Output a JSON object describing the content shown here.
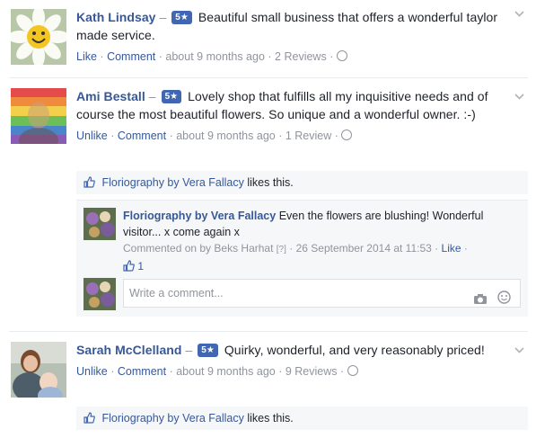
{
  "reviews": [
    {
      "name": "Kath Lindsay",
      "dash": "–",
      "rating": "5★",
      "text": "Beautiful small business that offers a wonderful taylor made service.",
      "actions": {
        "like": "Like",
        "comment": "Comment",
        "time": "about 9 months ago",
        "reviews": "2 Reviews"
      }
    },
    {
      "name": "Ami Bestall",
      "dash": "–",
      "rating": "5★",
      "text": "Lovely shop that fulfills all my inquisitive needs and of course the most beautiful flowers. So unique and a wonderful owner. :-)",
      "actions": {
        "like": "Unlike",
        "comment": "Comment",
        "time": "about 9 months ago",
        "reviews": "1 Review"
      },
      "likes": {
        "page": "Floriography by Vera Fallacy",
        "suffix": "likes this."
      },
      "reply": {
        "page": "Floriography by Vera Fallacy",
        "text": "Even the flowers are blushing! Wonderful visitor... x come again x",
        "commented_by_prefix": "Commented on by",
        "commented_by": "Beks Harhat",
        "commented_by_mark": "[?]",
        "date": "26 September 2014 at 11:53",
        "like": "Like",
        "like_count": "1"
      },
      "comment_placeholder": "Write a comment..."
    },
    {
      "name": "Sarah McClelland",
      "dash": "–",
      "rating": "5★",
      "text": "Quirky, wonderful, and very reasonably priced!",
      "actions": {
        "like": "Unlike",
        "comment": "Comment",
        "time": "about 9 months ago",
        "reviews": "9 Reviews"
      },
      "likes": {
        "page": "Floriography by Vera Fallacy",
        "suffix": "likes this."
      }
    }
  ],
  "separator": "·",
  "colors": {
    "link": "#365899",
    "badge": "#4267b2",
    "muted": "#90949c",
    "panel": "#f6f7f9"
  }
}
